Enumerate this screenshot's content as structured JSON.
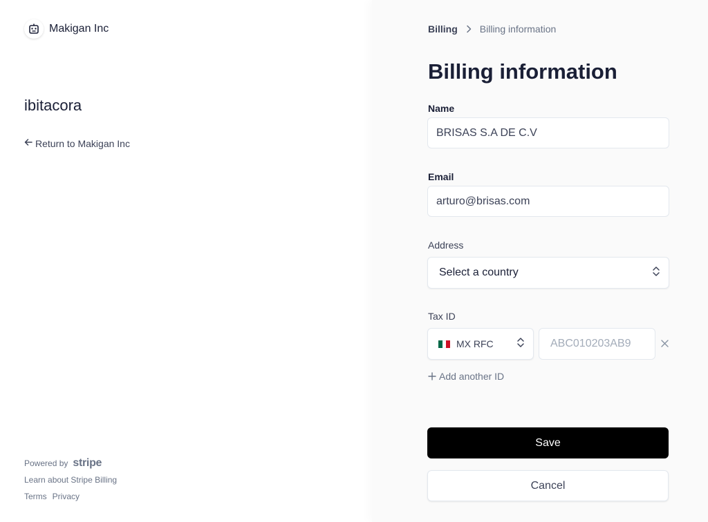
{
  "brand": {
    "name": "Makigan Inc",
    "logo_icon": "robot-icon"
  },
  "account": {
    "name": "ibitacora"
  },
  "return_link": {
    "label": "Return to Makigan Inc"
  },
  "footer": {
    "powered_by": "Powered by",
    "stripe": "stripe",
    "learn": "Learn about Stripe Billing",
    "terms": "Terms",
    "privacy": "Privacy"
  },
  "breadcrumb": {
    "root": "Billing",
    "current": "Billing information"
  },
  "page": {
    "title": "Billing information"
  },
  "form": {
    "name": {
      "label": "Name",
      "value": "BRISAS S.A DE C.V"
    },
    "email": {
      "label": "Email",
      "value": "arturo@brisas.com"
    },
    "address": {
      "label": "Address",
      "country_placeholder": "Select a country"
    },
    "tax": {
      "label": "Tax ID",
      "type": "MX RFC",
      "flag_colors": [
        "#006847",
        "#ffffff",
        "#ce1126"
      ],
      "placeholder": "ABC010203AB9",
      "add_label": "Add another ID"
    },
    "save_label": "Save",
    "cancel_label": "Cancel"
  },
  "colors": {
    "primary_button": "#000000",
    "page_bg_right": "#fafafa",
    "text": "#1a1f36"
  }
}
